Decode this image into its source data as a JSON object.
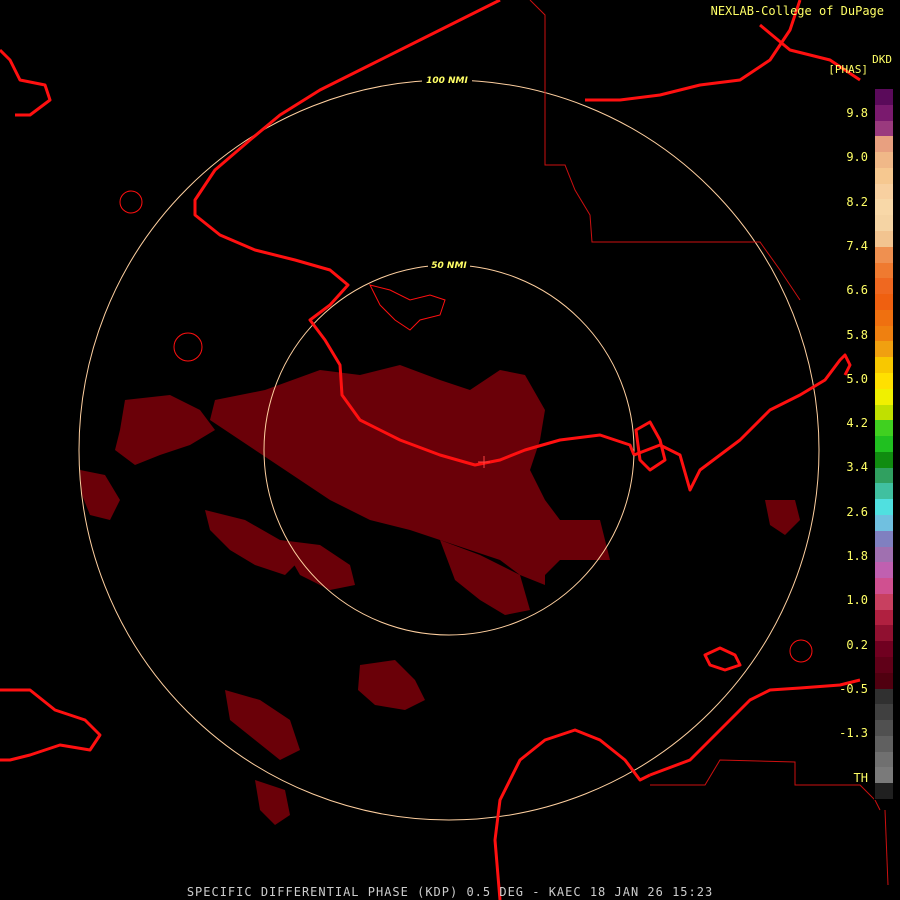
{
  "header": {
    "credit": "NEXLAB-College of DuPage",
    "product_code": "DKD",
    "units": "[PHAS]"
  },
  "footer": {
    "caption": "SPECIFIC DIFFERENTIAL PHASE (KDP) 0.5 DEG - KAEC 18 JAN 26 15:23"
  },
  "range_rings": [
    {
      "label": "100 NMI"
    },
    {
      "label": "50 NMI"
    }
  ],
  "legend": {
    "ticks": [
      "9.8",
      "9.0",
      "8.2",
      "7.4",
      "6.6",
      "5.8",
      "5.0",
      "4.2",
      "3.4",
      "2.6",
      "1.8",
      "1.0",
      "0.2",
      "-0.5",
      "-1.3",
      "TH"
    ],
    "colors": [
      "#5a0a5a",
      "#7a1a6e",
      "#9a3a7e",
      "#e8a080",
      "#f0b888",
      "#f6c890",
      "#f8d0a0",
      "#f8d8a8",
      "#f5d4a4",
      "#f2c490",
      "#ef9050",
      "#ef7a30",
      "#ef6820",
      "#ef6010",
      "#ef7010",
      "#ef8010",
      "#f0a010",
      "#f8c800",
      "#ffe000",
      "#f0f000",
      "#c0e000",
      "#40d020",
      "#20c020",
      "#108c10",
      "#30a060",
      "#40c0a0",
      "#50e0e0",
      "#70c0e0",
      "#8080c0",
      "#a070b0",
      "#c060b0",
      "#d05090",
      "#c84060",
      "#b02040",
      "#901030",
      "#700020",
      "#600018",
      "#500010",
      "#303030",
      "#404040",
      "#505050",
      "#606060",
      "#707070",
      "#7a7a7a",
      "#202020"
    ]
  },
  "colors": {
    "echo": "#6a0008",
    "coast": "#ff1010",
    "boundary": "#cc1010",
    "ring": "#ffd0a0"
  }
}
